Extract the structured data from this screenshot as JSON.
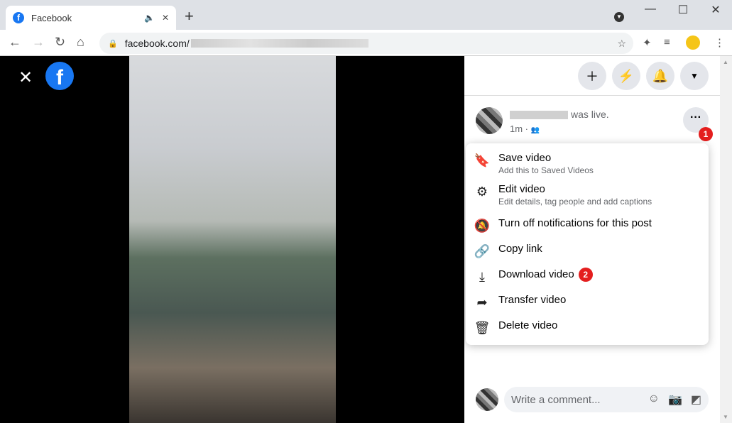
{
  "browser": {
    "tab_title": "Facebook",
    "url": "facebook.com/",
    "new_tab": "+"
  },
  "header": {
    "buttons": [
      "create",
      "messenger",
      "notifications",
      "account"
    ]
  },
  "post": {
    "suffix": "was live.",
    "time": "1m ·"
  },
  "menu": {
    "items": [
      {
        "label": "Save video",
        "sub": "Add this to Saved Videos",
        "icon": "bookmark-icon"
      },
      {
        "label": "Edit video",
        "sub": "Edit details, tag people and add captions",
        "icon": "gears-icon"
      },
      {
        "label": "Turn off notifications for this post",
        "icon": "bell-off-icon"
      },
      {
        "label": "Copy link",
        "icon": "link-icon"
      },
      {
        "label": "Download video",
        "icon": "download-icon"
      },
      {
        "label": "Transfer video",
        "icon": "share-arrow-icon"
      },
      {
        "label": "Delete video",
        "icon": "trash-icon"
      }
    ]
  },
  "badges": {
    "one": "1",
    "two": "2"
  },
  "comment": {
    "placeholder": "Write a comment..."
  },
  "colors": {
    "facebook_blue": "#1877f2",
    "badge_red": "#e41e1e"
  }
}
